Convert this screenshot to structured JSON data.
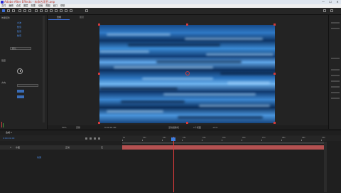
{
  "window": {
    "title": "Adobe After Effects - 未命名项目.aep",
    "controls": [
      "—",
      "☐",
      "✕"
    ]
  },
  "menu": [
    "文件",
    "编辑",
    "合成",
    "图层",
    "效果",
    "动画",
    "视图",
    "窗口",
    "帮助"
  ],
  "left_panel": {
    "rows": [
      {
        "label": "效果控件",
        "value": "水波"
      },
      {
        "label": "",
        "value": "数值"
      },
      {
        "label": "",
        "value": "数值"
      },
      {
        "label": "",
        "value": "数值"
      }
    ],
    "dropdown": "默认",
    "section": "强度",
    "section2": "方向"
  },
  "viewer": {
    "tabs": [
      "合成",
      "图层"
    ],
    "footer": [
      "50%",
      "完整",
      "0:00:01:00",
      "活动摄像机",
      "1个视图",
      "+0.0"
    ]
  },
  "timeline": {
    "tab": "合成 1",
    "timecode": "0:00:01:00",
    "layer_index": "1",
    "layer_name": "水面",
    "mode": "正常",
    "parent": "无",
    "sub_label": "效果",
    "ruler_marks": [
      "0s",
      "01s",
      "02s",
      "03s",
      "04s",
      "05s",
      "06s",
      "07s",
      "08s",
      "09s",
      "10s"
    ]
  },
  "colors": {
    "accent": "#3c6fd8",
    "layer_bar": "#b45151",
    "playhead": "#d63a3a"
  }
}
